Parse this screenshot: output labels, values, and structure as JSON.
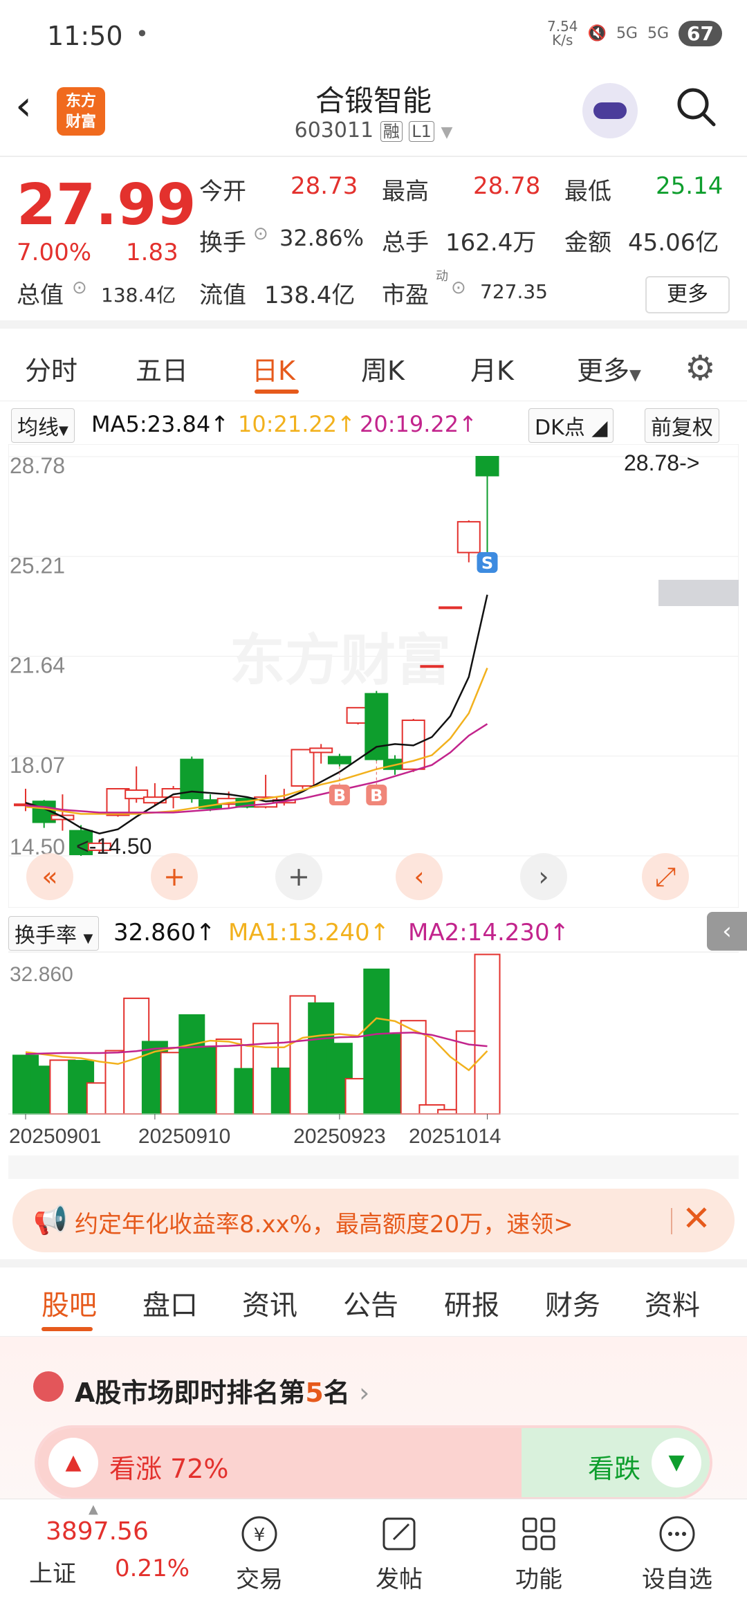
{
  "status": {
    "time": "11:50",
    "dot": "•",
    "speed_top": "7.54",
    "speed_bottom": "K/s",
    "signal1": "5G",
    "signal2": "5G",
    "battery": "67"
  },
  "header": {
    "back_icon": "back-arrow-icon",
    "logo_line1": "东方",
    "logo_line2": "财富",
    "title": "合锻智能",
    "code": "603011",
    "tag_margin": "融",
    "tag_level": "L1"
  },
  "quote": {
    "price": "27.99",
    "pct": "7.00%",
    "change": "1.83",
    "open_label": "今开",
    "open": "28.73",
    "high_label": "最高",
    "high": "28.78",
    "low_label": "最低",
    "low": "25.14",
    "turnover_label": "换手",
    "turnover": "32.86%",
    "volume_label": "总手",
    "volume": "162.4万",
    "amount_label": "金额",
    "amount": "45.06亿",
    "mktcap_label": "总值",
    "mktcap": "138.4亿",
    "float_label": "流值",
    "float": "138.4亿",
    "pe_label": "市盈",
    "pe_sup": "动",
    "pe": "727.35",
    "more_btn": "更多"
  },
  "tabs": [
    "分时",
    "五日",
    "日K",
    "周K",
    "月K",
    "更多"
  ],
  "ma_line": {
    "selector": "均线",
    "ma5": "MA5:23.84↑",
    "ma10": "10:21.22↑",
    "ma20": "20:19.22↑",
    "dk": "DK点",
    "adjust": "前复权"
  },
  "turn_line": {
    "selector": "换手率",
    "value": "32.860↑",
    "ma1": "MA1:13.240↑",
    "ma2": "MA2:14.230↑",
    "axis_top": "32.860"
  },
  "chart_data": {
    "type": "candlestick",
    "y_ticks": [
      "28.78",
      "25.21",
      "21.64",
      "18.07",
      "14.50"
    ],
    "ylim": [
      14.5,
      28.78
    ],
    "high_label": "28.78->",
    "low_label": "<-14.50",
    "x_ticks": [
      "20250901",
      "20250910",
      "20250923",
      "20251014"
    ],
    "watermark": "东方财富",
    "markers": {
      "buy": "B",
      "sell": "S"
    },
    "candles": [
      {
        "o": 16.35,
        "c": 16.35,
        "h": 16.9,
        "l": 16.1
      },
      {
        "o": 16.45,
        "c": 15.7,
        "h": 16.5,
        "l": 15.5
      },
      {
        "o": 15.8,
        "c": 15.95,
        "h": 16.7,
        "l": 15.4
      },
      {
        "o": 15.4,
        "c": 14.55,
        "h": 15.6,
        "l": 14.5
      },
      {
        "o": 14.7,
        "c": 14.95,
        "h": 15.1,
        "l": 14.6
      },
      {
        "o": 15.95,
        "c": 16.9,
        "h": 16.9,
        "l": 15.9
      },
      {
        "o": 16.55,
        "c": 16.85,
        "h": 17.7,
        "l": 16.4
      },
      {
        "o": 16.4,
        "c": 16.6,
        "h": 17.1,
        "l": 16.3
      },
      {
        "o": 16.6,
        "c": 16.9,
        "h": 17.0,
        "l": 16.2
      },
      {
        "o": 17.95,
        "c": 16.55,
        "h": 18.05,
        "l": 16.4
      },
      {
        "o": 16.5,
        "c": 16.2,
        "h": 16.7,
        "l": 16.1
      },
      {
        "o": 16.35,
        "c": 16.55,
        "h": 16.8,
        "l": 16.2
      },
      {
        "o": 16.55,
        "c": 16.25,
        "h": 16.6,
        "l": 16.2
      },
      {
        "o": 16.25,
        "c": 16.6,
        "h": 17.4,
        "l": 16.2
      },
      {
        "o": 16.4,
        "c": 16.5,
        "h": 16.9,
        "l": 16.3
      },
      {
        "o": 17.0,
        "c": 18.3,
        "h": 18.3,
        "l": 16.9
      },
      {
        "o": 18.2,
        "c": 18.35,
        "h": 18.5,
        "l": 17.8
      },
      {
        "o": 18.05,
        "c": 17.8,
        "h": 18.15,
        "l": 17.7
      },
      {
        "o": 19.25,
        "c": 19.8,
        "h": 19.8,
        "l": 19.2
      },
      {
        "o": 20.3,
        "c": 17.95,
        "h": 20.4,
        "l": 17.9
      },
      {
        "o": 17.95,
        "c": 17.6,
        "h": 18.1,
        "l": 17.4
      },
      {
        "o": 17.6,
        "c": 19.35,
        "h": 19.4,
        "l": 17.5
      },
      {
        "o": 21.3,
        "c": 21.3,
        "h": 21.3,
        "l": 21.3
      },
      {
        "o": 23.4,
        "c": 23.4,
        "h": 23.4,
        "l": 23.4
      },
      {
        "o": 25.35,
        "c": 26.45,
        "h": 26.5,
        "l": 25.0
      },
      {
        "o": 28.78,
        "c": 28.1,
        "h": 28.78,
        "l": 25.14
      }
    ],
    "series": [
      {
        "name": "MA5",
        "values": [
          16.4,
          16.2,
          15.9,
          15.5,
          15.3,
          15.45,
          15.9,
          16.3,
          16.7,
          16.8,
          16.75,
          16.7,
          16.6,
          16.45,
          16.5,
          16.8,
          17.15,
          17.5,
          17.95,
          18.4,
          18.5,
          18.45,
          18.75,
          19.5,
          20.9,
          23.84
        ]
      },
      {
        "name": "MA10",
        "values": [
          16.25,
          16.2,
          16.1,
          16.0,
          16.0,
          16.0,
          16.0,
          16.05,
          16.1,
          16.2,
          16.3,
          16.4,
          16.45,
          16.55,
          16.65,
          16.85,
          17.05,
          17.2,
          17.4,
          17.6,
          17.75,
          17.9,
          18.1,
          18.7,
          19.6,
          21.22
        ]
      },
      {
        "name": "MA20",
        "values": [
          16.3,
          16.25,
          16.15,
          16.1,
          16.05,
          16.05,
          16.05,
          16.05,
          16.05,
          16.1,
          16.15,
          16.2,
          16.3,
          16.35,
          16.45,
          16.55,
          16.7,
          16.85,
          17.0,
          17.15,
          17.35,
          17.55,
          17.75,
          18.2,
          18.8,
          19.22
        ]
      }
    ]
  },
  "turnover_data": {
    "ylim": [
      0,
      32.86
    ],
    "bars": [
      {
        "v": 12.3,
        "up": false
      },
      {
        "v": 10.0,
        "up": false
      },
      {
        "v": 11.3,
        "up": true
      },
      {
        "v": 11.2,
        "up": false
      },
      {
        "v": 6.5,
        "up": true
      },
      {
        "v": 13.3,
        "up": true
      },
      {
        "v": 24.3,
        "up": true
      },
      {
        "v": 15.2,
        "up": false
      },
      {
        "v": 12.9,
        "up": true
      },
      {
        "v": 20.8,
        "up": false
      },
      {
        "v": 14.2,
        "up": false
      },
      {
        "v": 15.7,
        "up": true
      },
      {
        "v": 9.5,
        "up": false
      },
      {
        "v": 19.0,
        "up": true
      },
      {
        "v": 9.6,
        "up": false
      },
      {
        "v": 24.8,
        "up": true
      },
      {
        "v": 23.3,
        "up": false
      },
      {
        "v": 14.8,
        "up": false
      },
      {
        "v": 7.4,
        "up": true
      },
      {
        "v": 30.4,
        "up": false
      },
      {
        "v": 16.7,
        "up": false
      },
      {
        "v": 19.6,
        "up": true
      },
      {
        "v": 1.9,
        "up": true
      },
      {
        "v": 0.9,
        "up": true
      },
      {
        "v": 17.4,
        "up": true
      },
      {
        "v": 40.0,
        "up": true
      }
    ],
    "ma1": [
      13.0,
      12.5,
      12.0,
      11.7,
      11.0,
      10.5,
      11.7,
      13.1,
      13.8,
      14.6,
      15.4,
      15.2,
      14.3,
      14.0,
      14.0,
      16.0,
      16.5,
      16.8,
      16.4,
      20.1,
      19.5,
      17.6,
      16.0,
      12.0,
      9.2,
      13.24
    ],
    "ma2": [
      12.6,
      12.7,
      12.8,
      12.8,
      12.8,
      12.9,
      13.2,
      13.7,
      13.9,
      14.0,
      14.2,
      14.3,
      14.5,
      14.8,
      15.0,
      15.4,
      15.8,
      16.1,
      16.2,
      16.8,
      17.0,
      17.1,
      16.6,
      15.6,
      14.6,
      14.23
    ]
  },
  "promo": {
    "text": "约定年化收益率8.xx%，最高额度20万，速领>"
  },
  "subtabs": [
    "股吧",
    "盘口",
    "资讯",
    "公告",
    "研报",
    "财务",
    "资料"
  ],
  "rank": {
    "text_prefix": "A股市场即时排名第",
    "rank_no": "5",
    "text_suffix": "名"
  },
  "vote": {
    "up": "看涨 72%",
    "up_pct": 72,
    "down": "看跌"
  },
  "bottom": {
    "index_value": "3897.56",
    "index_name": "上证",
    "index_pct": "0.21%",
    "nav": [
      "交易",
      "发帖",
      "功能",
      "设自选"
    ]
  },
  "colors": {
    "up": "#e3312d",
    "down": "#0e9e2d",
    "accent": "#e65a1c",
    "ma5": "#111111",
    "ma10": "#f2b11d",
    "ma20": "#c2248c"
  }
}
